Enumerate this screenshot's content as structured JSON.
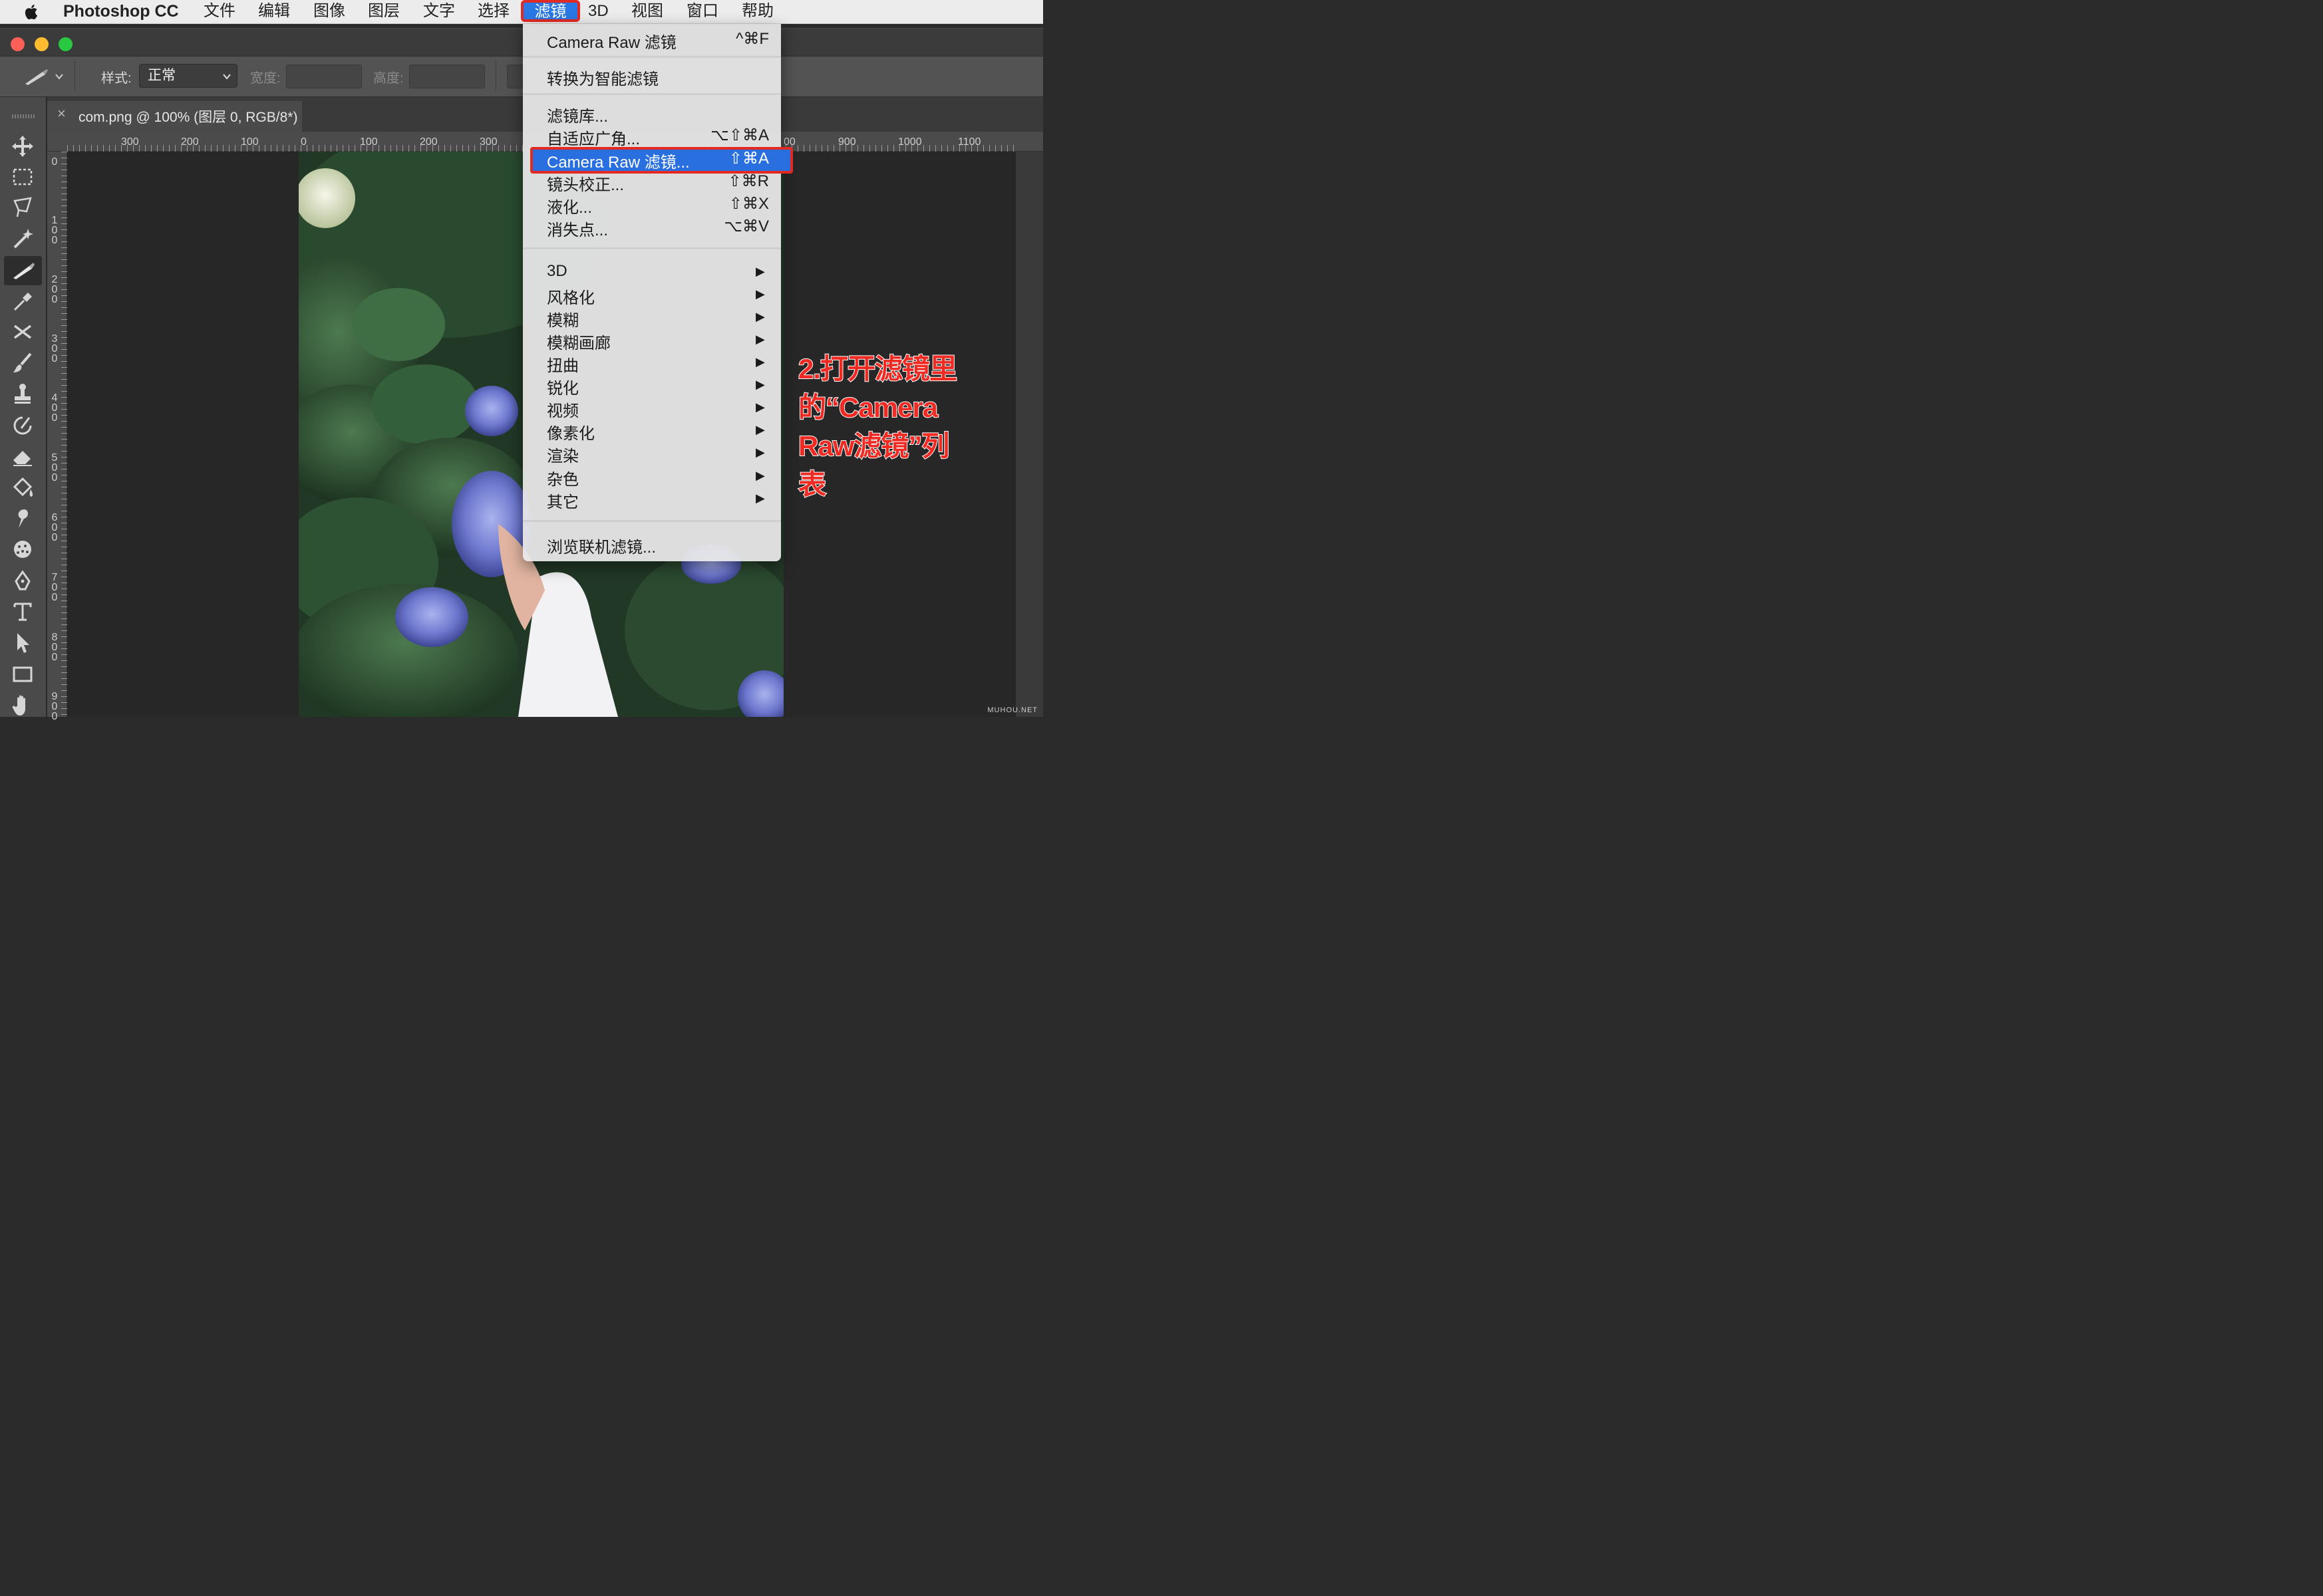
{
  "menubar": {
    "app_name": "Photoshop CC",
    "items": [
      "文件",
      "编辑",
      "图像",
      "图层",
      "文字",
      "选择",
      "滤镜",
      "3D",
      "视图",
      "窗口",
      "帮助"
    ],
    "active_item": "滤镜"
  },
  "options_bar": {
    "style_label": "样式:",
    "style_value": "正常",
    "width_label": "宽度:",
    "height_label": "高度:"
  },
  "document_tab": {
    "close_symbol": "×",
    "title": "com.png @ 100% (图层 0, RGB/8*)"
  },
  "ruler": {
    "top_ticks": [
      "300",
      "200",
      "100",
      "0",
      "100",
      "200",
      "300",
      "00",
      "900",
      "1000",
      "1100"
    ],
    "left_ticks": [
      "0",
      "100",
      "200",
      "300",
      "400",
      "500",
      "600",
      "700",
      "800",
      "900"
    ]
  },
  "filter_menu": {
    "top_items": [
      {
        "label": "Camera Raw 滤镜",
        "shortcut": "^⌘F"
      },
      {
        "label": "转换为智能滤镜",
        "shortcut": ""
      }
    ],
    "mid_items": [
      {
        "label": "滤镜库...",
        "shortcut": ""
      },
      {
        "label": "自适应广角...",
        "shortcut": "⌥⇧⌘A"
      },
      {
        "label": "Camera Raw 滤镜...",
        "shortcut": "⇧⌘A",
        "highlighted": true
      },
      {
        "label": "镜头校正...",
        "shortcut": "⇧⌘R"
      },
      {
        "label": "液化...",
        "shortcut": "⇧⌘X"
      },
      {
        "label": "消失点...",
        "shortcut": "⌥⌘V"
      }
    ],
    "submenus": [
      "3D",
      "风格化",
      "模糊",
      "模糊画廊",
      "扭曲",
      "锐化",
      "视频",
      "像素化",
      "渲染",
      "杂色",
      "其它"
    ],
    "bottom_item": "浏览联机滤镜..."
  },
  "annotation": {
    "lines": [
      "2.打开滤镜里",
      "的“Camera",
      "Raw滤镜”列",
      "表"
    ]
  },
  "watermark": "MUHOU.NET",
  "colors": {
    "highlight": "#2a6fe0",
    "annotation_red": "#ef2a22",
    "menu_bg": "#e8e8e8"
  },
  "icons": [
    "apple-logo-icon",
    "move-tool-icon",
    "marquee-tool-icon",
    "lasso-tool-icon",
    "magic-wand-icon",
    "slice-tool-icon",
    "eyedropper-icon",
    "healing-icon",
    "brush-icon",
    "stamp-icon",
    "history-brush-icon",
    "eraser-icon",
    "paint-bucket-icon",
    "smudge-icon",
    "sponge-icon",
    "pen-icon",
    "type-icon",
    "path-select-icon",
    "rectangle-icon",
    "hand-icon"
  ]
}
